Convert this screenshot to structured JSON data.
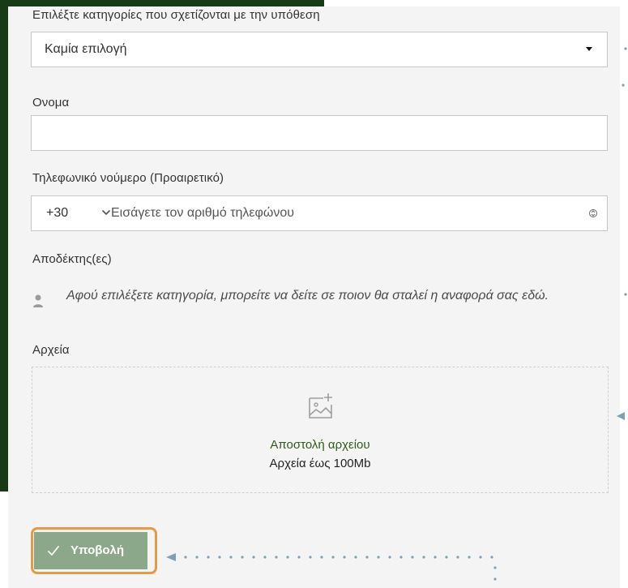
{
  "labels": {
    "category": "Επιλέξτε κατηγορίες που σχετίζονται με την υπόθεση",
    "name": "Ονομα",
    "phone": "Τηλεφωνικό νούμερο (Προαιρετικό)",
    "recipients": "Αποδέκτης(ες)",
    "files": "Αρχεία"
  },
  "category_select": {
    "value": "Καμία επιλογή"
  },
  "name_input": {
    "value": ""
  },
  "phone": {
    "country_code": "+30",
    "placeholder": "Εισάγετε τον αριθμό τηλεφώνου"
  },
  "recipients": {
    "note": "Αφού επιλέξετε κατηγορία, μπορείτε να δείτε σε ποιον θα σταλεί η αναφορά σας εδώ."
  },
  "upload": {
    "title": "Αποστολή αρχείου",
    "limit": "Αρχεία έως 100Mb"
  },
  "submit": {
    "label": "Υποβολή"
  },
  "colors": {
    "accent": "#8ba98a",
    "upload_link": "#2f5b18",
    "focus_ring": "#e69a45",
    "frame": "#163b16",
    "guide": "#7fa0b2"
  },
  "icons": {
    "select": "chevron-down-icon",
    "recipient": "person-icon",
    "upload": "image-add-icon",
    "submit": "check-icon"
  }
}
